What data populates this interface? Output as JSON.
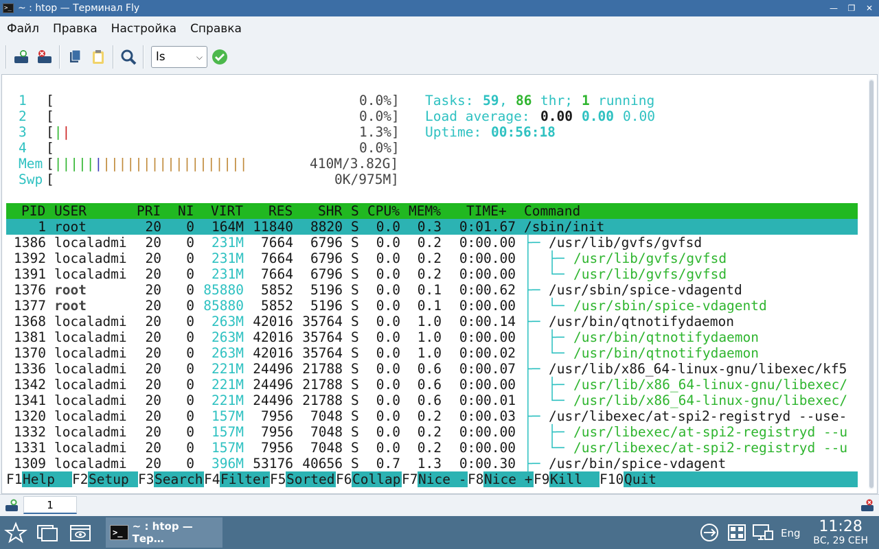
{
  "window": {
    "title": "~ : htop — Терминал Fly",
    "app_icon_text": ">_"
  },
  "menu": [
    "Файл",
    "Правка",
    "Настройка",
    "Справка"
  ],
  "toolbar": {
    "command_value": "ls"
  },
  "meters": {
    "cpus": [
      {
        "label": "1",
        "value": "0.0%]"
      },
      {
        "label": "2",
        "value": "0.0%]"
      },
      {
        "label": "3",
        "value": "1.3%]"
      },
      {
        "label": "4",
        "value": "0.0%]"
      }
    ],
    "mem": {
      "label": "Mem",
      "value": "410M/3.82G]"
    },
    "swp": {
      "label": "Swp",
      "value": "0K/975M]"
    },
    "tasks_label": "Tasks:",
    "tasks": "59",
    "threads": "86",
    "thr_label": "thr;",
    "running": "1",
    "running_label": "running",
    "load_label": "Load average:",
    "load1": "0.00",
    "load5": "0.00",
    "load15": "0.00",
    "uptime_label": "Uptime:",
    "uptime": "00:56:18"
  },
  "table": {
    "columns": [
      "PID",
      "USER",
      "PRI",
      "NI",
      "VIRT",
      "RES",
      "SHR",
      "S",
      "CPU%",
      "MEM%",
      "TIME+",
      "Command"
    ],
    "rows": [
      {
        "pid": "1",
        "user": "root",
        "pri": "20",
        "ni": "0",
        "virt": "164M",
        "res": "11840",
        "shr": "8820",
        "s": "S",
        "cpu": "0.0",
        "mem": "0.3",
        "time": "0:01.67",
        "tree": "",
        "cmd": "/sbin/init",
        "selected": true
      },
      {
        "pid": "1386",
        "user": "localadmi",
        "pri": "20",
        "ni": "0",
        "virt": "231M",
        "res": "7664",
        "shr": "6796",
        "s": "S",
        "cpu": "0.0",
        "mem": "0.2",
        "time": "0:00.00",
        "tree": "├─ ",
        "cmd": "/usr/lib/gvfs/gvfsd",
        "depth": 1
      },
      {
        "pid": "1392",
        "user": "localadmi",
        "pri": "20",
        "ni": "0",
        "virt": "231M",
        "res": "7664",
        "shr": "6796",
        "s": "S",
        "cpu": "0.0",
        "mem": "0.2",
        "time": "0:00.00",
        "tree": "│  ├─ ",
        "cmd": "/usr/lib/gvfs/gvfsd",
        "depth": 2
      },
      {
        "pid": "1391",
        "user": "localadmi",
        "pri": "20",
        "ni": "0",
        "virt": "231M",
        "res": "7664",
        "shr": "6796",
        "s": "S",
        "cpu": "0.0",
        "mem": "0.2",
        "time": "0:00.00",
        "tree": "│  └─ ",
        "cmd": "/usr/lib/gvfs/gvfsd",
        "depth": 2
      },
      {
        "pid": "1376",
        "user": "root",
        "pri": "20",
        "ni": "0",
        "virt": "85880",
        "res": "5852",
        "shr": "5196",
        "s": "S",
        "cpu": "0.0",
        "mem": "0.1",
        "time": "0:00.62",
        "tree": "├─ ",
        "cmd": "/usr/sbin/spice-vdagentd",
        "depth": 1
      },
      {
        "pid": "1377",
        "user": "root",
        "pri": "20",
        "ni": "0",
        "virt": "85880",
        "res": "5852",
        "shr": "5196",
        "s": "S",
        "cpu": "0.0",
        "mem": "0.1",
        "time": "0:00.00",
        "tree": "│  └─ ",
        "cmd": "/usr/sbin/spice-vdagentd",
        "depth": 2
      },
      {
        "pid": "1368",
        "user": "localadmi",
        "pri": "20",
        "ni": "0",
        "virt": "263M",
        "res": "42016",
        "shr": "35764",
        "s": "S",
        "cpu": "0.0",
        "mem": "1.0",
        "time": "0:00.14",
        "tree": "├─ ",
        "cmd": "/usr/bin/qtnotifydaemon",
        "depth": 1
      },
      {
        "pid": "1381",
        "user": "localadmi",
        "pri": "20",
        "ni": "0",
        "virt": "263M",
        "res": "42016",
        "shr": "35764",
        "s": "S",
        "cpu": "0.0",
        "mem": "1.0",
        "time": "0:00.00",
        "tree": "│  ├─ ",
        "cmd": "/usr/bin/qtnotifydaemon",
        "depth": 2
      },
      {
        "pid": "1370",
        "user": "localadmi",
        "pri": "20",
        "ni": "0",
        "virt": "263M",
        "res": "42016",
        "shr": "35764",
        "s": "S",
        "cpu": "0.0",
        "mem": "1.0",
        "time": "0:00.02",
        "tree": "│  └─ ",
        "cmd": "/usr/bin/qtnotifydaemon",
        "depth": 2
      },
      {
        "pid": "1336",
        "user": "localadmi",
        "pri": "20",
        "ni": "0",
        "virt": "221M",
        "res": "24496",
        "shr": "21788",
        "s": "S",
        "cpu": "0.0",
        "mem": "0.6",
        "time": "0:00.07",
        "tree": "├─ ",
        "cmd": "/usr/lib/x86_64-linux-gnu/libexec/kf5",
        "depth": 1
      },
      {
        "pid": "1342",
        "user": "localadmi",
        "pri": "20",
        "ni": "0",
        "virt": "221M",
        "res": "24496",
        "shr": "21788",
        "s": "S",
        "cpu": "0.0",
        "mem": "0.6",
        "time": "0:00.00",
        "tree": "│  ├─ ",
        "cmd": "/usr/lib/x86_64-linux-gnu/libexec/",
        "depth": 2
      },
      {
        "pid": "1341",
        "user": "localadmi",
        "pri": "20",
        "ni": "0",
        "virt": "221M",
        "res": "24496",
        "shr": "21788",
        "s": "S",
        "cpu": "0.0",
        "mem": "0.6",
        "time": "0:00.01",
        "tree": "│  └─ ",
        "cmd": "/usr/lib/x86_64-linux-gnu/libexec/",
        "depth": 2
      },
      {
        "pid": "1320",
        "user": "localadmi",
        "pri": "20",
        "ni": "0",
        "virt": "157M",
        "res": "7956",
        "shr": "7048",
        "s": "S",
        "cpu": "0.0",
        "mem": "0.2",
        "time": "0:00.03",
        "tree": "├─ ",
        "cmd": "/usr/libexec/at-spi2-registryd --use-",
        "depth": 1
      },
      {
        "pid": "1332",
        "user": "localadmi",
        "pri": "20",
        "ni": "0",
        "virt": "157M",
        "res": "7956",
        "shr": "7048",
        "s": "S",
        "cpu": "0.0",
        "mem": "0.2",
        "time": "0:00.00",
        "tree": "│  ├─ ",
        "cmd": "/usr/libexec/at-spi2-registryd --u",
        "depth": 2
      },
      {
        "pid": "1331",
        "user": "localadmi",
        "pri": "20",
        "ni": "0",
        "virt": "157M",
        "res": "7956",
        "shr": "7048",
        "s": "S",
        "cpu": "0.0",
        "mem": "0.2",
        "time": "0:00.00",
        "tree": "│  └─ ",
        "cmd": "/usr/libexec/at-spi2-registryd --u",
        "depth": 2
      },
      {
        "pid": "1309",
        "user": "localadmi",
        "pri": "20",
        "ni": "0",
        "virt": "396M",
        "res": "53176",
        "shr": "40656",
        "s": "S",
        "cpu": "0.7",
        "mem": "1.3",
        "time": "0:00.30",
        "tree": "├─ ",
        "cmd": "/usr/bin/spice-vdagent",
        "depth": 1
      }
    ]
  },
  "fkeys": [
    {
      "key": "F1",
      "label": "Help  "
    },
    {
      "key": "F2",
      "label": "Setup "
    },
    {
      "key": "F3",
      "label": "Search"
    },
    {
      "key": "F4",
      "label": "Filter"
    },
    {
      "key": "F5",
      "label": "Sorted"
    },
    {
      "key": "F6",
      "label": "Collap"
    },
    {
      "key": "F7",
      "label": "Nice -"
    },
    {
      "key": "F8",
      "label": "Nice +"
    },
    {
      "key": "F9",
      "label": "Kill  "
    },
    {
      "key": "F10",
      "label": "Quit  "
    }
  ],
  "tabs": [
    {
      "label": "1"
    }
  ],
  "taskbar": {
    "task_title": "~ : htop — Тер…",
    "task_icon_text": ">_",
    "lang": "Eng",
    "time": "11:28",
    "date": "ВС, 29 СЕН"
  },
  "colors": {
    "titlebar": "#3c6ea5",
    "header": "#21b821",
    "selected": "#2cb3b3",
    "taskbar": "#4a6f8c"
  }
}
